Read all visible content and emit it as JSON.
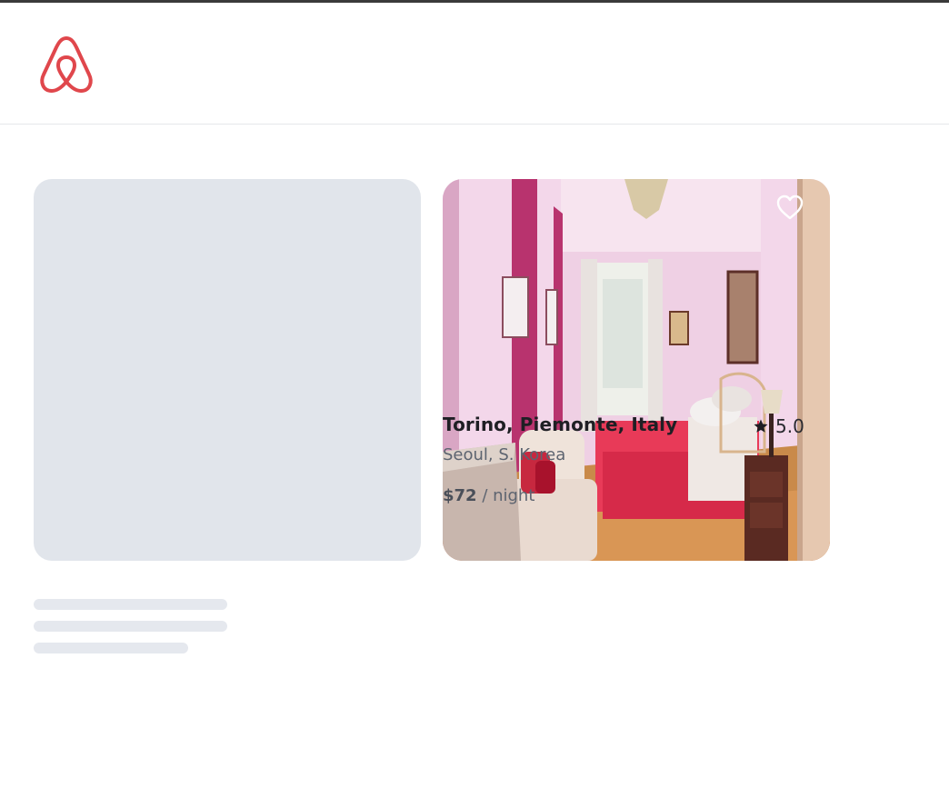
{
  "brand": {
    "logo_icon": "airbnb-logo-icon",
    "accent_color": "#e0474c"
  },
  "listings": [
    {
      "state": "loading"
    },
    {
      "state": "loaded",
      "title": "Torino, Piemonte, Italy",
      "rating": "5.0",
      "location": "Seoul, S. Korea",
      "price": "$72",
      "price_unit": "/ night",
      "favorite_icon": "heart-outline-icon",
      "rating_icon": "star-icon",
      "photo_description_icon": "bedroom-photo"
    }
  ],
  "colors": {
    "skeleton": "#e1e5eb",
    "text_primary": "#1f1f24",
    "text_secondary": "#5d6470"
  }
}
